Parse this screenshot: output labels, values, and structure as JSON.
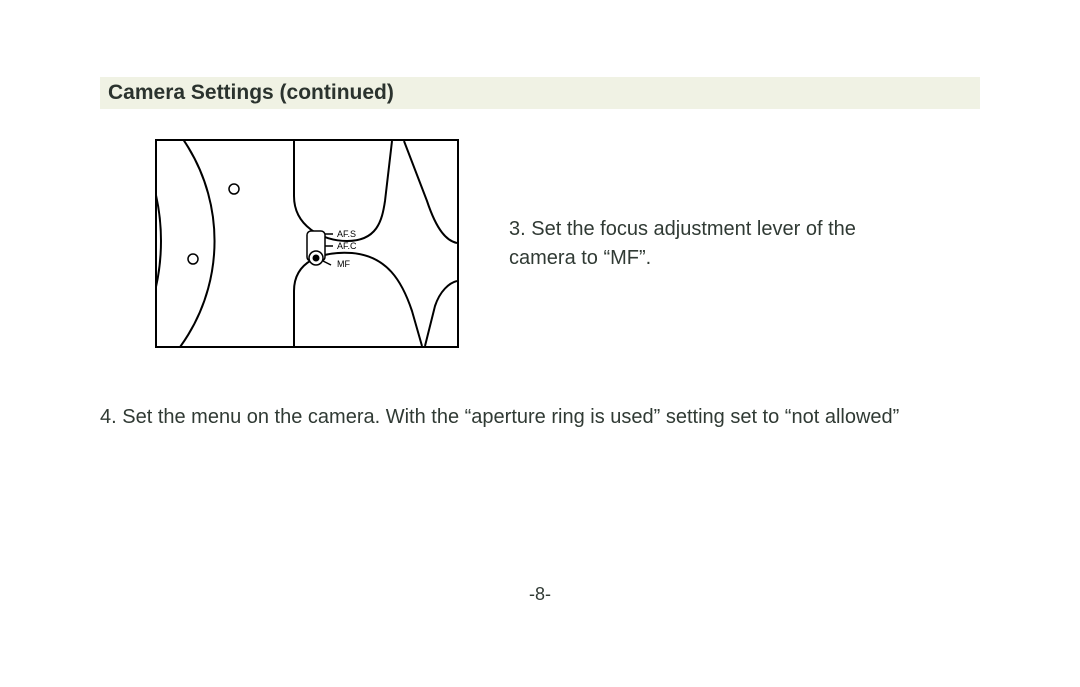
{
  "section_title": "Camera Settings (continued)",
  "step3": "3. Set the focus adjustment lever of the camera to “MF”.",
  "step4": "4.  Set the menu on the camera. With the “aperture ring is used” setting set to “not allowed”",
  "page_number": "-8-",
  "diagram_labels": {
    "afs": "AF.S",
    "afc": "AF.C",
    "mf": "MF"
  }
}
